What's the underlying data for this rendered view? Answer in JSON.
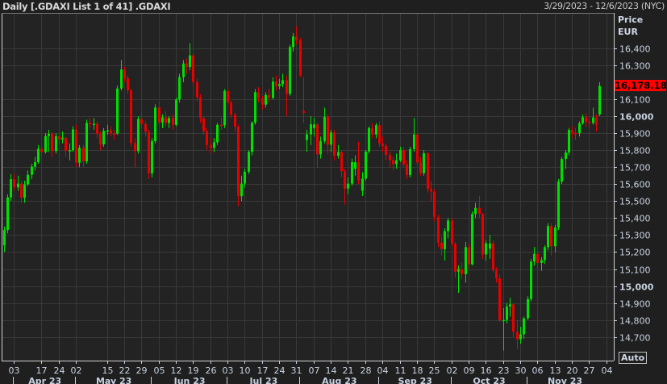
{
  "header": {
    "title": "Daily [.GDAXI List 1 of 41] .GDAXI",
    "date_range": "3/29/2023 - 12/6/2023 (NYC)"
  },
  "axis": {
    "price_label": "Price",
    "currency": "EUR",
    "auto_button": "Auto",
    "last_price": "16,178.180"
  },
  "colors": {
    "up": "#00e000",
    "down": "#e80000",
    "grid": "#383938",
    "background": "#222322",
    "last_price_bg": "#ff0000"
  },
  "chart_data": {
    "type": "candlestick",
    "title": "Daily [.GDAXI List 1 of 41] .GDAXI",
    "ylabel": "Price EUR",
    "ylim": [
      14561,
      16608
    ],
    "yticks": [
      {
        "v": 14700,
        "label": "14,700"
      },
      {
        "v": 14800,
        "label": "14,800"
      },
      {
        "v": 14900,
        "label": "14,900"
      },
      {
        "v": 15000,
        "label": "15,000",
        "bold": true
      },
      {
        "v": 15100,
        "label": "15,100"
      },
      {
        "v": 15200,
        "label": "15,200"
      },
      {
        "v": 15300,
        "label": "15,300"
      },
      {
        "v": 15400,
        "label": "15,400"
      },
      {
        "v": 15500,
        "label": "15,500"
      },
      {
        "v": 15600,
        "label": "15,600"
      },
      {
        "v": 15700,
        "label": "15,700"
      },
      {
        "v": 15800,
        "label": "15,800"
      },
      {
        "v": 15900,
        "label": "15,900"
      },
      {
        "v": 16000,
        "label": "16,000",
        "bold": true
      },
      {
        "v": 16100,
        "label": "16,100"
      },
      {
        "v": 16300,
        "label": "16,300"
      },
      {
        "v": 16400,
        "label": "16,400"
      }
    ],
    "xticks": [
      {
        "i": 3,
        "label": "03"
      },
      {
        "i": 11,
        "label": "17"
      },
      {
        "i": 16,
        "label": "24"
      },
      {
        "i": 21,
        "label": "02"
      },
      {
        "i": 30,
        "label": "15"
      },
      {
        "i": 35,
        "label": "22"
      },
      {
        "i": 40,
        "label": "29"
      },
      {
        "i": 45,
        "label": "05"
      },
      {
        "i": 50,
        "label": "12"
      },
      {
        "i": 55,
        "label": "19"
      },
      {
        "i": 60,
        "label": "26"
      },
      {
        "i": 65,
        "label": "03"
      },
      {
        "i": 70,
        "label": "10"
      },
      {
        "i": 75,
        "label": "17"
      },
      {
        "i": 80,
        "label": "24"
      },
      {
        "i": 85,
        "label": "31"
      },
      {
        "i": 90,
        "label": "07"
      },
      {
        "i": 95,
        "label": "14"
      },
      {
        "i": 100,
        "label": "21"
      },
      {
        "i": 105,
        "label": "28"
      },
      {
        "i": 110,
        "label": "04"
      },
      {
        "i": 115,
        "label": "11"
      },
      {
        "i": 120,
        "label": "18"
      },
      {
        "i": 125,
        "label": "25"
      },
      {
        "i": 130,
        "label": "02"
      },
      {
        "i": 135,
        "label": "09"
      },
      {
        "i": 140,
        "label": "16"
      },
      {
        "i": 145,
        "label": "23"
      },
      {
        "i": 150,
        "label": "30"
      },
      {
        "i": 155,
        "label": "06"
      },
      {
        "i": 160,
        "label": "13"
      },
      {
        "i": 165,
        "label": "20"
      },
      {
        "i": 170,
        "label": "27"
      },
      {
        "i": 175,
        "label": "04"
      }
    ],
    "months": [
      {
        "start": 3,
        "end": 21,
        "label": "Apr 23"
      },
      {
        "start": 21,
        "end": 43,
        "label": "May 23"
      },
      {
        "start": 43,
        "end": 65,
        "label": "Jun 23"
      },
      {
        "start": 65,
        "end": 86,
        "label": "Jul 23"
      },
      {
        "start": 86,
        "end": 109,
        "label": "Aug 23"
      },
      {
        "start": 109,
        "end": 130,
        "label": "Sep 23"
      },
      {
        "start": 130,
        "end": 152,
        "label": "Oct 23"
      },
      {
        "start": 152,
        "end": 174,
        "label": "Nov 23"
      }
    ],
    "ohlc": [
      [
        15240,
        15350,
        15200,
        15330
      ],
      [
        15330,
        15540,
        15310,
        15522
      ],
      [
        15522,
        15660,
        15500,
        15629
      ],
      [
        15629,
        15660,
        15560,
        15581
      ],
      [
        15581,
        15650,
        15560,
        15603
      ],
      [
        15603,
        15620,
        15490,
        15520
      ],
      [
        15520,
        15620,
        15490,
        15598
      ],
      [
        15598,
        15680,
        15590,
        15655
      ],
      [
        15655,
        15720,
        15630,
        15703
      ],
      [
        15703,
        15760,
        15680,
        15729
      ],
      [
        15729,
        15830,
        15720,
        15808
      ],
      [
        15808,
        15830,
        15760,
        15789
      ],
      [
        15789,
        15900,
        15780,
        15883
      ],
      [
        15883,
        15920,
        15790,
        15896
      ],
      [
        15896,
        15910,
        15760,
        15795
      ],
      [
        15795,
        15900,
        15780,
        15882
      ],
      [
        15882,
        15900,
        15830,
        15864
      ],
      [
        15864,
        15910,
        15840,
        15872
      ],
      [
        15872,
        15880,
        15760,
        15796
      ],
      [
        15796,
        15840,
        15740,
        15800
      ],
      [
        15800,
        15940,
        15790,
        15922
      ],
      [
        15922,
        15950,
        15700,
        15726
      ],
      [
        15726,
        15830,
        15700,
        15815
      ],
      [
        15815,
        15830,
        15700,
        15734
      ],
      [
        15734,
        15980,
        15720,
        15961
      ],
      [
        15961,
        15990,
        15930,
        15952
      ],
      [
        15952,
        15990,
        15920,
        15955
      ],
      [
        15955,
        15970,
        15870,
        15897
      ],
      [
        15897,
        15910,
        15800,
        15834
      ],
      [
        15834,
        15930,
        15820,
        15914
      ],
      [
        15914,
        15950,
        15890,
        15917
      ],
      [
        15917,
        15940,
        15880,
        15898
      ],
      [
        15898,
        15920,
        15860,
        15897
      ],
      [
        15897,
        16180,
        15890,
        16163
      ],
      [
        16163,
        16330,
        16150,
        16275
      ],
      [
        16275,
        16290,
        16200,
        16223
      ],
      [
        16223,
        16240,
        16130,
        16152
      ],
      [
        16152,
        16160,
        15820,
        15842
      ],
      [
        15842,
        15870,
        15700,
        15794
      ],
      [
        15794,
        16000,
        15780,
        15984
      ],
      [
        15984,
        16020,
        15930,
        15953
      ],
      [
        15953,
        15970,
        15880,
        15909
      ],
      [
        15909,
        15920,
        15630,
        15664
      ],
      [
        15664,
        15870,
        15640,
        15853
      ],
      [
        15853,
        16070,
        15840,
        16051
      ],
      [
        16051,
        16080,
        15940,
        15963
      ],
      [
        15963,
        16010,
        15930,
        15993
      ],
      [
        15993,
        16030,
        15940,
        15960
      ],
      [
        15960,
        16000,
        15930,
        15989
      ],
      [
        15989,
        16010,
        15920,
        15949
      ],
      [
        15949,
        16110,
        15940,
        16098
      ],
      [
        16098,
        16250,
        16080,
        16230
      ],
      [
        16230,
        16330,
        16200,
        16310
      ],
      [
        16310,
        16340,
        16250,
        16290
      ],
      [
        16290,
        16430,
        16270,
        16358
      ],
      [
        16358,
        16370,
        16180,
        16201
      ],
      [
        16201,
        16220,
        16090,
        16111
      ],
      [
        16111,
        16130,
        15960,
        15988
      ],
      [
        15988,
        16000,
        15890,
        15912
      ],
      [
        15912,
        15930,
        15800,
        15830
      ],
      [
        15830,
        15870,
        15780,
        15813
      ],
      [
        15813,
        15870,
        15790,
        15846
      ],
      [
        15846,
        15960,
        15830,
        15949
      ],
      [
        15949,
        15990,
        15920,
        15946
      ],
      [
        15946,
        16160,
        15930,
        16148
      ],
      [
        16148,
        16170,
        16060,
        16081
      ],
      [
        16081,
        16090,
        15990,
        16009
      ],
      [
        16009,
        16020,
        15910,
        15937
      ],
      [
        15937,
        15950,
        15470,
        15529
      ],
      [
        15529,
        15650,
        15500,
        15603
      ],
      [
        15603,
        15690,
        15580,
        15673
      ],
      [
        15673,
        15800,
        15660,
        15790
      ],
      [
        15790,
        15970,
        15770,
        15962
      ],
      [
        15962,
        16160,
        15950,
        16141
      ],
      [
        16141,
        16170,
        16080,
        16105
      ],
      [
        16105,
        16120,
        16040,
        16068
      ],
      [
        16068,
        16140,
        16050,
        16125
      ],
      [
        16125,
        16160,
        16080,
        16108
      ],
      [
        16108,
        16230,
        16100,
        16204
      ],
      [
        16204,
        16240,
        16150,
        16177
      ],
      [
        16177,
        16220,
        16160,
        16190
      ],
      [
        16190,
        16250,
        16170,
        16212
      ],
      [
        16212,
        16240,
        16000,
        16132
      ],
      [
        16132,
        16420,
        16120,
        16407
      ],
      [
        16407,
        16490,
        16380,
        16469
      ],
      [
        16469,
        16530,
        16420,
        16447
      ],
      [
        16447,
        16460,
        16230,
        16240
      ],
      [
        16030,
        16230,
        15960,
        16020
      ],
      [
        15860,
        15920,
        15790,
        15893
      ],
      [
        15893,
        16000,
        15830,
        15952
      ],
      [
        15930,
        15990,
        15880,
        15951
      ],
      [
        15951,
        15960,
        15700,
        15775
      ],
      [
        15775,
        15880,
        15750,
        15853
      ],
      [
        15853,
        16050,
        15840,
        15997
      ],
      [
        15997,
        16010,
        15780,
        15832
      ],
      [
        15832,
        15920,
        15790,
        15904
      ],
      [
        15904,
        15920,
        15740,
        15767
      ],
      [
        15767,
        15830,
        15750,
        15789
      ],
      [
        15789,
        15800,
        15640,
        15676
      ],
      [
        15676,
        15690,
        15480,
        15574
      ],
      [
        15574,
        15640,
        15540,
        15603
      ],
      [
        15603,
        15750,
        15590,
        15729
      ],
      [
        15690,
        15770,
        15650,
        15729
      ],
      [
        15729,
        15850,
        15600,
        15622
      ],
      [
        15560,
        15670,
        15530,
        15632
      ],
      [
        15632,
        15800,
        15620,
        15792
      ],
      [
        15792,
        15940,
        15780,
        15930
      ],
      [
        15930,
        15960,
        15870,
        15892
      ],
      [
        15892,
        15960,
        15870,
        15947
      ],
      [
        15947,
        15970,
        15820,
        15840
      ],
      [
        15840,
        15880,
        15790,
        15825
      ],
      [
        15825,
        15840,
        15740,
        15772
      ],
      [
        15772,
        15790,
        15700,
        15741
      ],
      [
        15741,
        15760,
        15680,
        15718
      ],
      [
        15718,
        15780,
        15690,
        15740
      ],
      [
        15740,
        15820,
        15730,
        15800
      ],
      [
        15800,
        15820,
        15700,
        15715
      ],
      [
        15715,
        15740,
        15630,
        15654
      ],
      [
        15654,
        15820,
        15640,
        15806
      ],
      [
        15806,
        15990,
        15790,
        15893
      ],
      [
        15893,
        15900,
        15710,
        15727
      ],
      [
        15727,
        15760,
        15650,
        15664
      ],
      [
        15664,
        15800,
        15650,
        15782
      ],
      [
        15782,
        15790,
        15550,
        15572
      ],
      [
        15572,
        15620,
        15500,
        15557
      ],
      [
        15557,
        15570,
        15380,
        15406
      ],
      [
        15406,
        15420,
        15230,
        15255
      ],
      [
        15255,
        15290,
        15180,
        15217
      ],
      [
        15217,
        15340,
        15150,
        15323
      ],
      [
        15323,
        15400,
        15280,
        15386
      ],
      [
        15386,
        15400,
        15230,
        15247
      ],
      [
        15247,
        15260,
        15050,
        15085
      ],
      [
        15085,
        15120,
        14960,
        15099
      ],
      [
        15099,
        15140,
        15040,
        15070
      ],
      [
        15070,
        15260,
        15020,
        15229
      ],
      [
        15229,
        15250,
        15100,
        15128
      ],
      [
        15128,
        15440,
        15120,
        15424
      ],
      [
        15424,
        15490,
        15400,
        15460
      ],
      [
        15460,
        15530,
        15400,
        15425
      ],
      [
        15425,
        15430,
        15160,
        15186
      ],
      [
        15186,
        15270,
        15150,
        15252
      ],
      [
        15220,
        15300,
        15160,
        15251
      ],
      [
        15251,
        15270,
        15080,
        15095
      ],
      [
        15095,
        15110,
        15020,
        15045
      ],
      [
        15045,
        15070,
        14790,
        14798
      ],
      [
        14798,
        14870,
        14620,
        14800
      ],
      [
        14800,
        14900,
        14780,
        14880
      ],
      [
        14880,
        14930,
        14820,
        14892
      ],
      [
        14892,
        14900,
        14700,
        14731
      ],
      [
        14731,
        14800,
        14630,
        14687
      ],
      [
        14687,
        14760,
        14660,
        14716
      ],
      [
        14716,
        14820,
        14690,
        14810
      ],
      [
        14810,
        14940,
        14800,
        14923
      ],
      [
        14923,
        15160,
        14910,
        15144
      ],
      [
        15144,
        15230,
        15120,
        15189
      ],
      [
        15189,
        15220,
        15100,
        15136
      ],
      [
        15136,
        15170,
        15090,
        15153
      ],
      [
        15153,
        15240,
        15130,
        15229
      ],
      [
        15229,
        15370,
        15210,
        15353
      ],
      [
        15353,
        15370,
        15180,
        15234
      ],
      [
        15234,
        15360,
        15200,
        15345
      ],
      [
        15345,
        15630,
        15330,
        15615
      ],
      [
        15615,
        15760,
        15600,
        15748
      ],
      [
        15748,
        15800,
        15690,
        15786
      ],
      [
        15786,
        15930,
        15770,
        15919
      ],
      [
        15919,
        15940,
        15870,
        15901
      ],
      [
        15901,
        15930,
        15860,
        15900
      ],
      [
        15900,
        15970,
        15880,
        15958
      ],
      [
        15958,
        16010,
        15950,
        15994
      ],
      [
        15994,
        16020,
        15940,
        15967
      ],
      [
        15967,
        16000,
        15930,
        15960
      ],
      [
        15960,
        16050,
        15950,
        15992
      ],
      [
        15992,
        16010,
        15910,
        15950
      ],
      [
        16010,
        16200,
        16000,
        16178.18
      ]
    ],
    "last_value": 16178.18
  }
}
